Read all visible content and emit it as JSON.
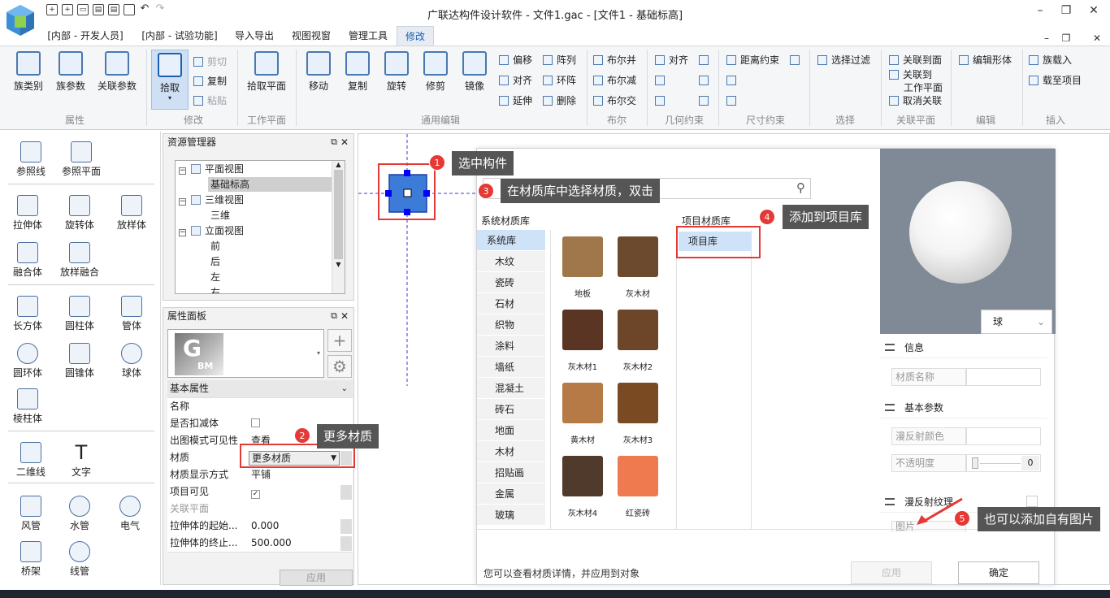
{
  "title": "广联达构件设计软件 - 文件1.gac - [文件1 - 基础标高]",
  "tabs": [
    "[内部 - 开发人员]",
    "[内部 - 试验功能]",
    "导入导出",
    "视图视窗",
    "管理工具",
    "修改"
  ],
  "ribbon": {
    "big": [
      "族类别",
      "族参数",
      "关联参数",
      "拾取",
      "拾取平面",
      "移动",
      "复制",
      "旋转",
      "修剪",
      "镜像"
    ],
    "clip": [
      "剪切",
      "复制",
      "粘贴"
    ],
    "edit_small": [
      "偏移",
      "阵列",
      "对齐",
      "环阵",
      "延伸",
      "删除"
    ],
    "bool": [
      "布尔并",
      "布尔减",
      "布尔交"
    ],
    "geo": [
      "对齐"
    ],
    "dim": [
      "距离约束"
    ],
    "select": [
      "选择过滤"
    ],
    "link": [
      "关联到面",
      "关联到",
      "工作平面",
      "取消关联"
    ],
    "editshape": [
      "编辑形体"
    ],
    "insert": [
      "族载入",
      "载至项目"
    ],
    "groups": [
      "属性",
      "修改",
      "工作平面",
      "通用编辑",
      "布尔",
      "几何约束",
      "尺寸约束",
      "选择",
      "关联平面",
      "编辑",
      "插入"
    ]
  },
  "toolbox": [
    "参照线",
    "参照平面",
    "拉伸体",
    "旋转体",
    "放样体",
    "融合体",
    "放样融合",
    "长方体",
    "圆柱体",
    "管体",
    "圆环体",
    "圆锥体",
    "球体",
    "棱柱体",
    "二维线",
    "文字",
    "风管",
    "水管",
    "电气",
    "桥架",
    "线管"
  ],
  "resource": {
    "title": "资源管理器",
    "tree": [
      "平面视图",
      "基础标高",
      "三维视图",
      "三维",
      "立面视图",
      "前",
      "后",
      "左",
      "右"
    ]
  },
  "props": {
    "title": "属性面板",
    "logo": "G BM",
    "group": "基本属性",
    "rows": [
      {
        "k": "名称",
        "v": ""
      },
      {
        "k": "是否扣减体",
        "v": ""
      },
      {
        "k": "出图模式可见性",
        "v": "查看"
      },
      {
        "k": "材质",
        "v": "更多材质"
      },
      {
        "k": "材质显示方式",
        "v": "平铺"
      },
      {
        "k": "项目可见",
        "v": "✓"
      },
      {
        "k": "关联平面",
        "v": ""
      },
      {
        "k": "拉伸体的起始...",
        "v": "0.000"
      },
      {
        "k": "拉伸体的终止...",
        "v": "500.000"
      }
    ],
    "apply": "应用"
  },
  "dialog": {
    "sys_title": "系统材质库",
    "proj_title": "项目材质库",
    "categories": [
      "系统库",
      "木纹",
      "瓷砖",
      "石材",
      "织物",
      "涂料",
      "墙纸",
      "混凝土",
      "砖石",
      "地面",
      "木材",
      "招贴画",
      "金属",
      "玻璃"
    ],
    "materials": [
      {
        "name": "地板",
        "color": "#a0774a"
      },
      {
        "name": "灰木材",
        "color": "#6b4a2d"
      },
      {
        "name": "灰木材1",
        "color": "#5a3524"
      },
      {
        "name": "灰木材2",
        "color": "#6d4528"
      },
      {
        "name": "黄木材",
        "color": "#b57a45"
      },
      {
        "name": "灰木材3",
        "color": "#7a4a22"
      },
      {
        "name": "灰木材4",
        "color": "#4f3a2c"
      },
      {
        "name": "红瓷砖",
        "color": "#f07a50"
      }
    ],
    "proj_item": "项目库",
    "shape": "球",
    "sections": [
      "信息",
      "基本参数",
      "漫反射纹理"
    ],
    "fields": [
      "材质名称",
      "漫反射颜色",
      "不透明度"
    ],
    "opacity": "0",
    "image_label": "图片",
    "hint": "您可以查看材质详情，并应用到对象",
    "apply": "应用",
    "ok": "确定"
  },
  "annotations": [
    {
      "n": "1",
      "text": "选中构件"
    },
    {
      "n": "2",
      "text": "更多材质"
    },
    {
      "n": "3",
      "text": "在材质库中选择材质，双击"
    },
    {
      "n": "4",
      "text": "添加到项目库"
    },
    {
      "n": "5",
      "text": "也可以添加自有图片"
    }
  ],
  "colors": {
    "accent": "#1a5fb4",
    "annotation_red": "#e53935",
    "callout_bg": "#555555"
  }
}
